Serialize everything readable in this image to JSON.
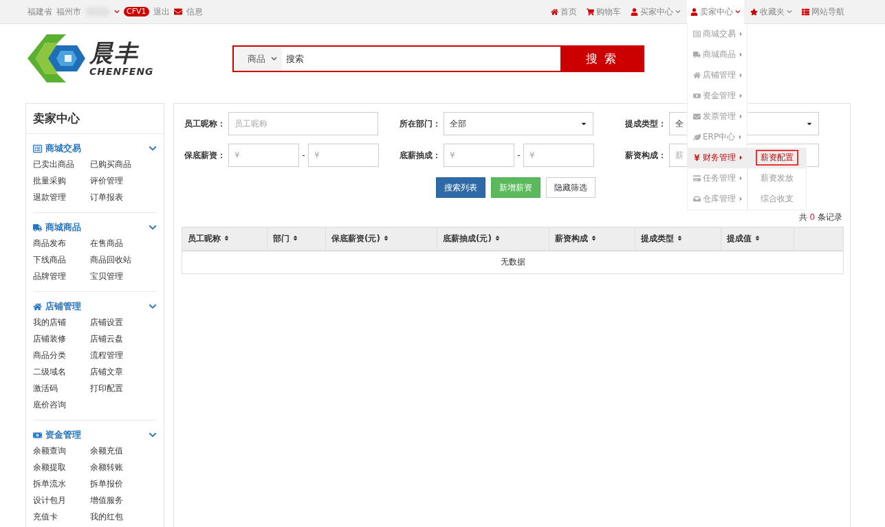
{
  "top_bar": {
    "location": [
      "福建省",
      "福州市"
    ],
    "badge": "CFV1",
    "logout": "退出",
    "messages": "信息",
    "nav": [
      {
        "label": "首页",
        "dropdown": false,
        "selected": false
      },
      {
        "label": "购物车",
        "dropdown": false,
        "selected": false
      },
      {
        "label": "买家中心",
        "dropdown": true,
        "selected": false
      },
      {
        "label": "卖家中心",
        "dropdown": true,
        "selected": true
      },
      {
        "label": "收藏夹",
        "dropdown": true,
        "selected": false
      },
      {
        "label": "网站导航",
        "dropdown": false,
        "selected": false
      }
    ]
  },
  "seller_menu": {
    "items": [
      {
        "label": "商城交易",
        "selected": false
      },
      {
        "label": "商城商品",
        "selected": false
      },
      {
        "label": "店铺管理",
        "selected": false
      },
      {
        "label": "资金管理",
        "selected": false
      },
      {
        "label": "发票管理",
        "selected": false
      },
      {
        "label": "ERP中心",
        "selected": false
      },
      {
        "label": "财务管理",
        "selected": true,
        "submenu": [
          {
            "label": "薪资配置",
            "selected": true
          },
          {
            "label": "薪资发放",
            "selected": false
          },
          {
            "label": "综合收支",
            "selected": false
          }
        ]
      },
      {
        "label": "任务管理",
        "selected": false
      },
      {
        "label": "仓库管理",
        "selected": false
      }
    ]
  },
  "logo": {
    "name": "晨丰",
    "subtitle": "CHENFENG"
  },
  "search": {
    "category": "商品",
    "placeholder": "搜索",
    "button": "搜 索"
  },
  "sidebar": {
    "title": "卖家中心",
    "sections": [
      {
        "title": "商城交易",
        "items": [
          "已卖出商品",
          "已购买商品",
          "批量采购",
          "评价管理",
          "退款管理",
          "订单报表"
        ]
      },
      {
        "title": "商城商品",
        "items": [
          "商品发布",
          "在售商品",
          "下线商品",
          "商品回收站",
          "品牌管理",
          "宝贝管理"
        ]
      },
      {
        "title": "店铺管理",
        "items": [
          "我的店铺",
          "店铺设置",
          "店铺装修",
          "店铺云盘",
          "商品分类",
          "流程管理",
          "二级域名",
          "店铺文章",
          "激活码",
          "打印配置",
          "底价咨询"
        ]
      },
      {
        "title": "资金管理",
        "items": [
          "余额查询",
          "余额充值",
          "余额提取",
          "余额转账",
          "拆单流水",
          "拆单报价",
          "设计包月",
          "增值服务",
          "充值卡",
          "我的红包"
        ]
      }
    ]
  },
  "filters": [
    {
      "label": "员工昵称：",
      "kind": "text",
      "placeholder": "员工昵称"
    },
    {
      "label": "所在部门：",
      "kind": "select",
      "value": "全部"
    },
    {
      "label": "提成类型：",
      "kind": "select",
      "value": "全"
    },
    {
      "label": "保底薪资：",
      "kind": "range",
      "placeholders": [
        "¥",
        "¥"
      ],
      "separator": "-"
    },
    {
      "label": "底薪抽成：",
      "kind": "range",
      "placeholders": [
        "¥",
        "¥"
      ],
      "separator": "-"
    },
    {
      "label": "薪资构成：",
      "kind": "text",
      "placeholder": "薪"
    }
  ],
  "buttons": [
    {
      "label": "搜索列表",
      "kind": "primary"
    },
    {
      "label": "新增薪资",
      "kind": "success"
    },
    {
      "label": "隐藏筛选",
      "kind": "default"
    }
  ],
  "record_count": {
    "prefix": "共",
    "count": "0",
    "suffix": "条记录"
  },
  "table": {
    "columns": [
      "员工昵称",
      "部门",
      "保底薪资(元)",
      "底薪抽成(元)",
      "薪资构成",
      "提成类型",
      "提成值"
    ],
    "empty": "无数据"
  }
}
